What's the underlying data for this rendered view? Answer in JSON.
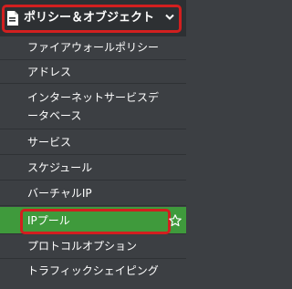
{
  "section": {
    "title": "ポリシー＆オブジェクト",
    "icon": "document-icon",
    "expand_icon": "chevron-down-icon"
  },
  "items": [
    {
      "label": "ファイアウォールポリシー"
    },
    {
      "label": "アドレス"
    },
    {
      "label_line1": "インターネットサービスデ",
      "label_line2": "ータベース"
    },
    {
      "label": "サービス"
    },
    {
      "label": "スケジュール"
    },
    {
      "label": "バーチャルIP"
    },
    {
      "label": "IPプール",
      "active": true,
      "favorite_icon": "star-outline-icon"
    },
    {
      "label": "プロトコルオプション"
    },
    {
      "label": "トラフィックシェイピング"
    }
  ],
  "colors": {
    "background": "#3c3f43",
    "active": "#3f9a3c",
    "highlight_frame": "#d21f1f"
  }
}
